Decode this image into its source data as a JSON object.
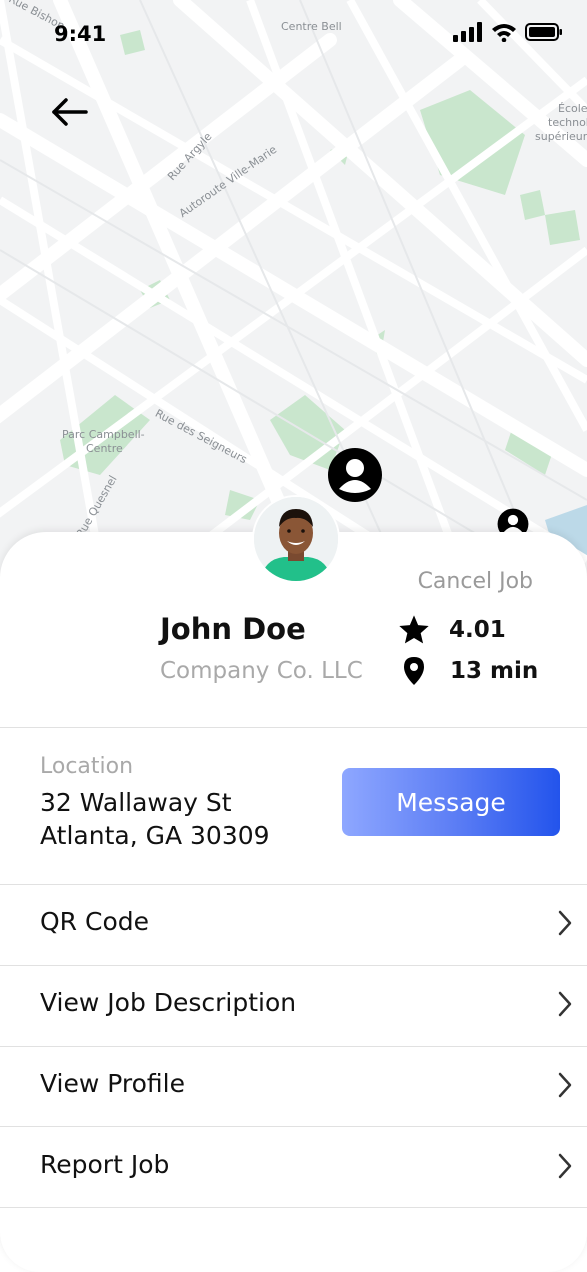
{
  "status_bar": {
    "time": "9:41"
  },
  "map": {
    "labels": {
      "bishop": "Rue Bishop",
      "centre_bell": "Centre Bell",
      "ecole": [
        "École",
        "technol",
        "supérieur"
      ],
      "argyle": "Rue Argyle",
      "autoroute": "Autoroute Ville-Marie",
      "parc": [
        "Parc Campbell-",
        "Centre"
      ],
      "seigneurs": "Rue des Seigneurs",
      "quesnel": "Rue Quesnel"
    }
  },
  "job": {
    "cancel_label": "Cancel Job",
    "name": "John Doe",
    "company": "Company Co. LLC",
    "rating": "4.01",
    "eta": "13 min"
  },
  "location": {
    "label": "Location",
    "line1": "32 Wallaway St",
    "line2": "Atlanta, GA 30309",
    "message_label": "Message"
  },
  "menu": [
    {
      "label": "QR Code"
    },
    {
      "label": "View Job Description"
    },
    {
      "label": "View Profile"
    },
    {
      "label": "Report Job"
    }
  ],
  "colors": {
    "accent_start": "#8ea7ff",
    "accent_end": "#2354ec",
    "map_green": "#c9e6cd"
  }
}
